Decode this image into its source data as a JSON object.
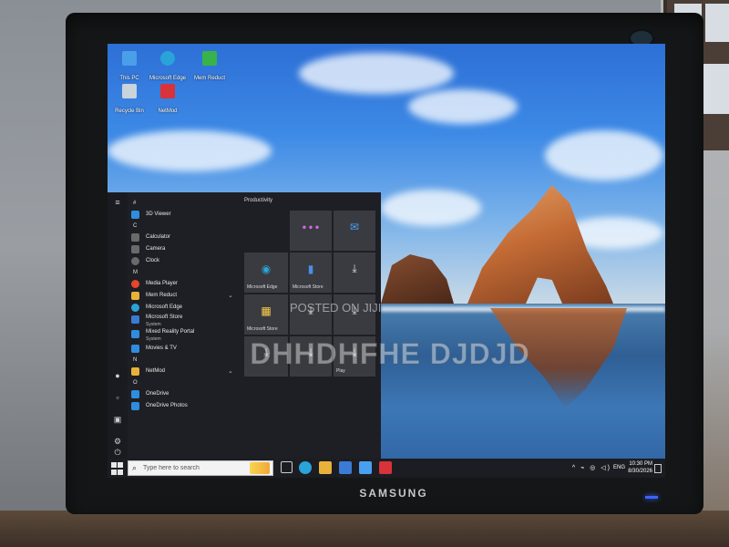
{
  "screen": {
    "title_bar_text": ""
  },
  "desktop_icons": [
    {
      "label": "This PC",
      "icon": "computer-icon",
      "color": "#4a9fe8"
    },
    {
      "label": "Microsoft Edge",
      "icon": "edge-icon",
      "color": "#2aa3d8"
    },
    {
      "label": "Mem Reduct",
      "icon": "memreduct-icon",
      "color": "#37b34a"
    },
    {
      "label": "Recycle Bin",
      "icon": "recycle-bin-icon",
      "color": "#c9d3dc"
    },
    {
      "label": "NetMod",
      "icon": "netmod-icon",
      "color": "#d8323a"
    }
  ],
  "start_menu": {
    "app_list": [
      {
        "type": "letter",
        "text": "#"
      },
      {
        "type": "app",
        "label": "3D Viewer",
        "icon": "cube-icon",
        "color": "#2e8de0"
      },
      {
        "type": "letter",
        "text": "C"
      },
      {
        "type": "app",
        "label": "Calculator",
        "icon": "calculator-icon",
        "color": "#6a6a6a"
      },
      {
        "type": "app",
        "label": "Camera",
        "icon": "camera-icon",
        "color": "#6a6a6a"
      },
      {
        "type": "app",
        "label": "Clock",
        "icon": "clock-icon",
        "color": "#6a6a6a"
      },
      {
        "type": "letter",
        "text": "M"
      },
      {
        "type": "app",
        "label": "Media Player",
        "icon": "media-player-icon",
        "color": "#e8452c"
      },
      {
        "type": "app",
        "label": "Mem Reduct",
        "icon": "folder-icon",
        "color": "#e8b23a",
        "expandable": true
      },
      {
        "type": "app",
        "label": "Microsoft Edge",
        "icon": "edge-icon",
        "color": "#2aa3d8"
      },
      {
        "type": "app",
        "label": "Microsoft Store",
        "sub": "System",
        "icon": "store-icon",
        "color": "#3a7bd5"
      },
      {
        "type": "app",
        "label": "Mixed Reality Portal",
        "sub": "System",
        "icon": "mixed-reality-icon",
        "color": "#2e8de0"
      },
      {
        "type": "app",
        "label": "Movies & TV",
        "icon": "movies-icon",
        "color": "#2e8de0"
      },
      {
        "type": "letter",
        "text": "N"
      },
      {
        "type": "app",
        "label": "NetMod",
        "icon": "folder-icon",
        "color": "#e8b23a",
        "expandable": true
      },
      {
        "type": "letter",
        "text": "O"
      },
      {
        "type": "app",
        "label": "OneDrive",
        "icon": "onedrive-icon",
        "color": "#2e8de0"
      },
      {
        "type": "app",
        "label": "OneDrive Photos",
        "icon": "photos-icon",
        "color": "#2e8de0"
      }
    ],
    "tiles_group_title": "Productivity",
    "tiles": [
      {
        "label": "",
        "icon": "office-icons-tile"
      },
      {
        "label": "",
        "icon": "mail-icon"
      },
      {
        "label": "Microsoft Edge",
        "icon": "edge-icon"
      },
      {
        "label": "Microsoft Store",
        "icon": "store-icon"
      },
      {
        "label": "",
        "icon": "download-icon"
      },
      {
        "label": "Microsoft Store",
        "icon": "store-icon"
      },
      {
        "label": "",
        "icon": "download-icon"
      },
      {
        "label": "",
        "icon": "download-icon"
      },
      {
        "label": "",
        "icon": "download-icon"
      },
      {
        "label": "",
        "icon": "download-icon"
      },
      {
        "label": "Play",
        "icon": "download-icon"
      }
    ]
  },
  "taskbar": {
    "search_placeholder": "Type here to search",
    "pinned_apps": [
      "task-view-icon",
      "edge-icon",
      "file-explorer-icon",
      "store-icon",
      "mail-icon",
      "netmod-icon"
    ],
    "tray": {
      "icons": "^ ⌁ ◎ ◁)",
      "language": "ENG",
      "time": "10:30 PM",
      "date": "8/30/2026"
    }
  },
  "watermark": {
    "text": "DHHDHFHE DJDJD",
    "posted": "POSTED ON JIJI"
  },
  "monitor": {
    "brand": "SAMSUNG"
  }
}
